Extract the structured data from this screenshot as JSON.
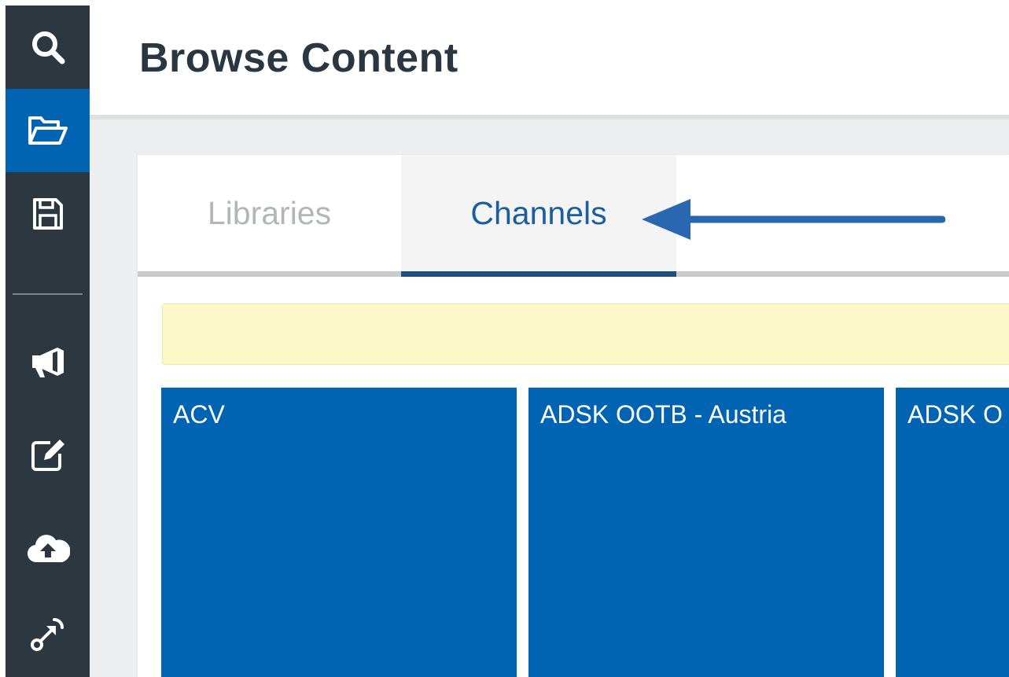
{
  "header": {
    "title": "Browse Content"
  },
  "rail": {
    "items": [
      {
        "icon": "search-icon",
        "active": false
      },
      {
        "icon": "folder-open-icon",
        "active": true
      },
      {
        "icon": "save-icon",
        "active": false
      },
      {
        "icon": "megaphone-icon",
        "active": false
      },
      {
        "icon": "edit-icon",
        "active": false
      },
      {
        "icon": "cloud-upload-icon",
        "active": false
      },
      {
        "icon": "share-link-icon",
        "active": false
      }
    ]
  },
  "tabs": [
    {
      "label": "Libraries",
      "selected": false
    },
    {
      "label": "Channels",
      "selected": true
    }
  ],
  "channels": [
    {
      "title": "ACV"
    },
    {
      "title": "ADSK OOTB - Austria"
    },
    {
      "title": "ADSK O"
    }
  ],
  "colors": {
    "rail_bg": "#2d3740",
    "accent": "#0064b2",
    "tab_active_text": "#1b5e9c",
    "notice_bg": "#fcf8c8",
    "annotation_arrow": "#2a67b1"
  }
}
